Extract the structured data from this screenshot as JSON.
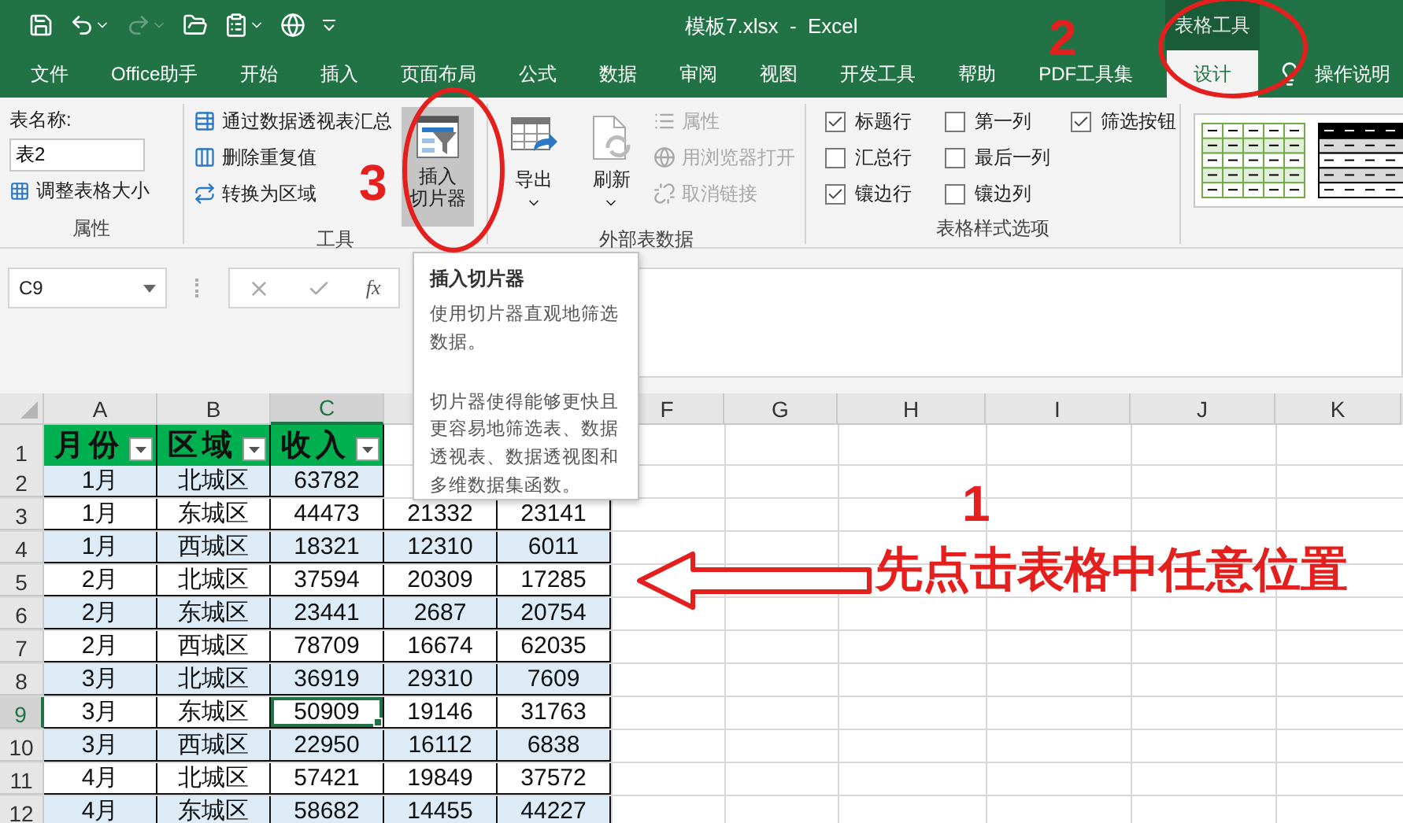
{
  "window": {
    "title": "模板7.xlsx  -  Excel",
    "context_tab_group": "表格工具"
  },
  "ribbon_tabs": [
    {
      "label": "文件",
      "selected": false
    },
    {
      "label": "Office助手",
      "selected": false
    },
    {
      "label": "开始",
      "selected": false
    },
    {
      "label": "插入",
      "selected": false
    },
    {
      "label": "页面布局",
      "selected": false
    },
    {
      "label": "公式",
      "selected": false
    },
    {
      "label": "数据",
      "selected": false
    },
    {
      "label": "审阅",
      "selected": false
    },
    {
      "label": "视图",
      "selected": false
    },
    {
      "label": "开发工具",
      "selected": false
    },
    {
      "label": "帮助",
      "selected": false
    },
    {
      "label": "PDF工具集",
      "selected": false
    },
    {
      "label": "设计",
      "selected": true
    }
  ],
  "tell_me": "操作说明",
  "properties_group": {
    "name_label": "表名称:",
    "name_value": "表2",
    "resize": "调整表格大小",
    "title": "属性"
  },
  "tools_group": {
    "items": [
      "通过数据透视表汇总",
      "删除重复值",
      "转换为区域"
    ],
    "slicer_button": {
      "lines": [
        "插入",
        "切片器"
      ],
      "hovered": true
    },
    "title": "工具"
  },
  "external_group": {
    "buttons": [
      {
        "label": "导出",
        "kind": "export"
      },
      {
        "label": "刷新",
        "kind": "refresh"
      }
    ],
    "items": [
      {
        "label": "属性",
        "kind": "properties",
        "disabled": true
      },
      {
        "label": "用浏览器打开",
        "kind": "browser",
        "disabled": true
      },
      {
        "label": "取消链接",
        "kind": "unlink",
        "disabled": true
      }
    ],
    "title": "外部表数据"
  },
  "style_options": {
    "options": [
      {
        "label": "标题行",
        "checked": true
      },
      {
        "label": "汇总行",
        "checked": false
      },
      {
        "label": "镶边行",
        "checked": true
      },
      {
        "label": "第一列",
        "checked": false
      },
      {
        "label": "最后一列",
        "checked": false
      },
      {
        "label": "镶边列",
        "checked": false
      },
      {
        "label": "筛选按钮",
        "checked": true
      }
    ],
    "title": "表格样式选项"
  },
  "formula_bar": {
    "name_box": "C9",
    "function_label": "fx"
  },
  "tooltip": {
    "title": "插入切片器",
    "paragraphs": [
      "使用切片器直观地筛选数据。",
      "切片器使得能够更快且更容易地筛选表、数据透视表、数据透视图和多维数据集函数。"
    ]
  },
  "sheet": {
    "columns": [
      {
        "label": "A",
        "selected": false
      },
      {
        "label": "B",
        "selected": false
      },
      {
        "label": "C",
        "selected": true
      },
      null,
      null,
      {
        "label": "F",
        "selected": false
      },
      {
        "label": "G",
        "selected": false
      },
      {
        "label": "H",
        "selected": false
      },
      {
        "label": "I",
        "selected": false
      },
      {
        "label": "J",
        "selected": false
      },
      {
        "label": "K",
        "selected": false
      }
    ],
    "rows": [
      {
        "number": "1",
        "kind": "header",
        "selected": false,
        "cells": [
          "月份",
          "区域",
          "收入"
        ]
      },
      {
        "number": "2",
        "kind": "data",
        "selected": false,
        "cells": [
          "1月",
          "北城区",
          "63782"
        ]
      },
      {
        "number": "3",
        "kind": "data",
        "selected": false,
        "cells": [
          "1月",
          "东城区",
          "44473",
          "21332",
          "23141"
        ]
      },
      {
        "number": "4",
        "kind": "data",
        "selected": false,
        "cells": [
          "1月",
          "西城区",
          "18321",
          "12310",
          "6011"
        ]
      },
      {
        "number": "5",
        "kind": "data",
        "selected": false,
        "cells": [
          "2月",
          "北城区",
          "37594",
          "20309",
          "17285"
        ]
      },
      {
        "number": "6",
        "kind": "data",
        "selected": false,
        "cells": [
          "2月",
          "东城区",
          "23441",
          "2687",
          "20754"
        ]
      },
      {
        "number": "7",
        "kind": "data",
        "selected": false,
        "cells": [
          "2月",
          "西城区",
          "78709",
          "16674",
          "62035"
        ]
      },
      {
        "number": "8",
        "kind": "data",
        "selected": false,
        "cells": [
          "3月",
          "北城区",
          "36919",
          "29310",
          "7609"
        ]
      },
      {
        "number": "9",
        "kind": "data",
        "selected": true,
        "cells": [
          "3月",
          "东城区",
          "50909",
          "19146",
          "31763"
        ]
      },
      {
        "number": "10",
        "kind": "data",
        "selected": false,
        "cells": [
          "3月",
          "西城区",
          "22950",
          "16112",
          "6838"
        ]
      },
      {
        "number": "11",
        "kind": "data",
        "selected": false,
        "cells": [
          "4月",
          "北城区",
          "57421",
          "19849",
          "37572"
        ]
      },
      {
        "number": "12",
        "kind": "data",
        "selected": false,
        "cells": [
          "4月",
          "东城区",
          "58682",
          "14455",
          "44227"
        ]
      }
    ]
  },
  "annotations": {
    "steps": [
      "1",
      "2",
      "3"
    ],
    "instruction": "先点击表格中任意位置"
  }
}
